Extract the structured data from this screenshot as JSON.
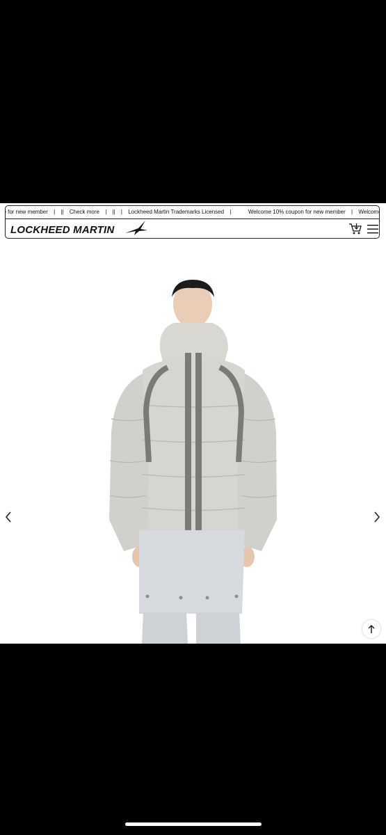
{
  "ticker": {
    "items": [
      "ge for new member",
      "||",
      "Check more",
      "||",
      "Lockheed Martin Trademarks Licensed",
      "Welcome 10% coupon for new member",
      "Welcome KAKAO"
    ],
    "separators": [
      "|",
      "|",
      "|",
      "|",
      "|"
    ]
  },
  "brand": {
    "logo_text": "LOCKHEED MARTIN"
  },
  "header": {
    "cart_badge": "1"
  },
  "product": {
    "jacket_color": "#d7d5cf",
    "stripe_color": "#7b7b76",
    "pants_color": "#d6dade",
    "background": "#ffffff"
  },
  "icons": {
    "cart": "cart-icon",
    "menu": "hamburger-menu-icon",
    "prev": "chevron-left-icon",
    "next": "chevron-right-icon",
    "top": "arrow-up-icon"
  }
}
